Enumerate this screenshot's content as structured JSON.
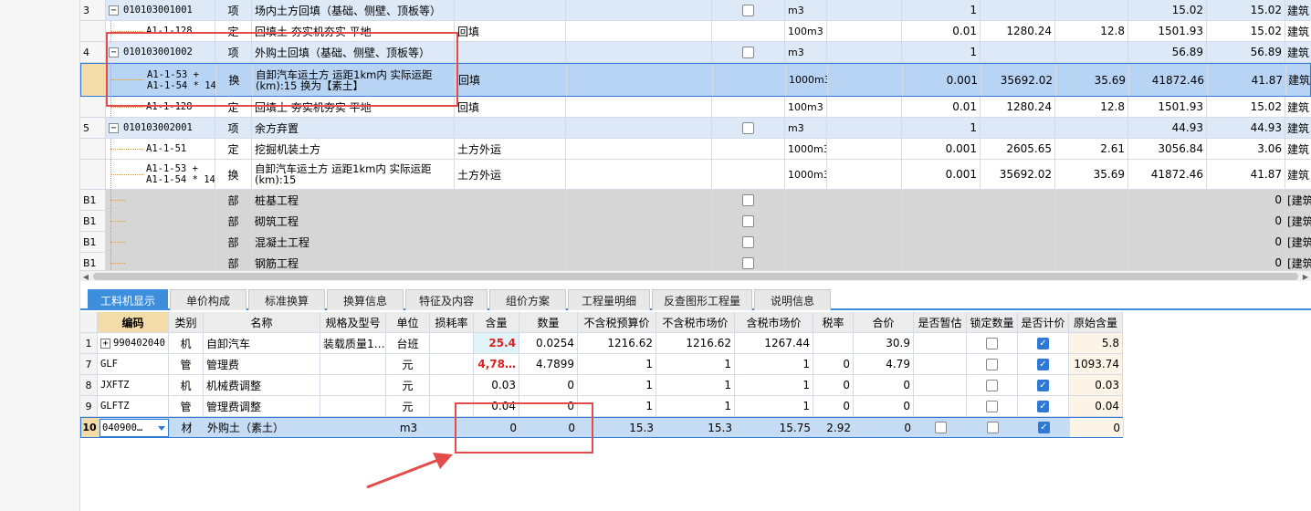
{
  "upper_table": {
    "rows": [
      {
        "type": "item",
        "idx": "3",
        "code": "010103001001",
        "kind": "项",
        "name": "场内土方回填（基础、侧壁、顶板等）",
        "spec": "",
        "unit": "m3",
        "qty": "1",
        "price": "",
        "labor": "",
        "budget": "15.02",
        "market": "15.02",
        "last": "建筑"
      },
      {
        "type": "sub",
        "idx": "",
        "code": "A1-1-128",
        "kind": "定",
        "name": "回填土 夯实机夯实 平地",
        "spec": "回填",
        "unit": "100m3",
        "qty": "0.01",
        "price": "1280.24",
        "labor": "12.8",
        "budget": "1501.93",
        "market": "15.02",
        "last": "建筑"
      },
      {
        "type": "item",
        "idx": "4",
        "code": "010103001002",
        "kind": "项",
        "name": "外购土回填（基础、侧壁、顶板等）",
        "spec": "",
        "unit": "m3",
        "qty": "1",
        "price": "",
        "labor": "",
        "budget": "56.89",
        "market": "56.89",
        "last": "建筑"
      },
      {
        "type": "selected",
        "idx": "",
        "code": "A1-1-53 + A1-1-54 * 14",
        "kind": "换",
        "name": "自卸汽车运土方 运距1km内  实际运距(km):15  换为【素土】",
        "spec": "回填",
        "unit": "1000m3",
        "qty": "0.001",
        "price": "35692.02",
        "labor": "35.69",
        "budget": "41872.46",
        "market": "41.87",
        "last": "建筑"
      },
      {
        "type": "sub",
        "idx": "",
        "code": "A1-1-128",
        "kind": "定",
        "name": "回填土 夯实机夯实 平地",
        "spec": "回填",
        "unit": "100m3",
        "qty": "0.01",
        "price": "1280.24",
        "labor": "12.8",
        "budget": "1501.93",
        "market": "15.02",
        "last": "建筑"
      },
      {
        "type": "item",
        "idx": "5",
        "code": "010103002001",
        "kind": "项",
        "name": "余方弃置",
        "spec": "",
        "unit": "m3",
        "qty": "1",
        "price": "",
        "labor": "",
        "budget": "44.93",
        "market": "44.93",
        "last": "建筑"
      },
      {
        "type": "sub",
        "idx": "",
        "code": "A1-1-51",
        "kind": "定",
        "name": "挖掘机装土方",
        "spec": "土方外运",
        "unit": "1000m3",
        "qty": "0.001",
        "price": "2605.65",
        "labor": "2.61",
        "budget": "3056.84",
        "market": "3.06",
        "last": "建筑"
      },
      {
        "type": "sub",
        "idx": "",
        "code": "A1-1-53 + A1-1-54 * 14",
        "kind": "换",
        "name": "自卸汽车运土方 运距1km内  实际运距(km):15",
        "spec": "土方外运",
        "unit": "1000m3",
        "qty": "0.001",
        "price": "35692.02",
        "labor": "35.69",
        "budget": "41872.46",
        "market": "41.87",
        "last": "建筑"
      },
      {
        "type": "part",
        "idx": "B1",
        "code": "",
        "kind": "部",
        "name": "桩基工程",
        "spec": "",
        "unit": "",
        "qty": "",
        "price": "",
        "labor": "",
        "budget": "",
        "market": "0",
        "last": "[建筑"
      },
      {
        "type": "part",
        "idx": "B1",
        "code": "",
        "kind": "部",
        "name": "砌筑工程",
        "spec": "",
        "unit": "",
        "qty": "",
        "price": "",
        "labor": "",
        "budget": "",
        "market": "0",
        "last": "[建筑"
      },
      {
        "type": "part",
        "idx": "B1",
        "code": "",
        "kind": "部",
        "name": "混凝土工程",
        "spec": "",
        "unit": "",
        "qty": "",
        "price": "",
        "labor": "",
        "budget": "",
        "market": "0",
        "last": "[建筑"
      },
      {
        "type": "part",
        "idx": "B1",
        "code": "",
        "kind": "部",
        "name": "钢筋工程",
        "spec": "",
        "unit": "",
        "qty": "",
        "price": "",
        "labor": "",
        "budget": "",
        "market": "0",
        "last": "[建筑"
      }
    ]
  },
  "tabs": [
    "工料机显示",
    "单价构成",
    "标准换算",
    "换算信息",
    "特征及内容",
    "组价方案",
    "工程量明细",
    "反查图形工程量",
    "说明信息"
  ],
  "lower_table": {
    "headers": [
      "编码",
      "类别",
      "名称",
      "规格及型号",
      "单位",
      "损耗率",
      "含量",
      "数量",
      "不含税预算价",
      "不含税市场价",
      "含税市场价",
      "税率",
      "合价",
      "是否暂估",
      "锁定数量",
      "是否计价",
      "原始含量"
    ],
    "rows": [
      {
        "idx": "1",
        "code": "990402040",
        "cat": "机",
        "name": "自卸汽车",
        "spec": "装载质量1…",
        "unit": "台班",
        "loss": "",
        "content": "25.4",
        "qty": "0.0254",
        "p1": "1216.62",
        "p2": "1216.62",
        "p3": "1267.44",
        "tax": "",
        "total": "30.9",
        "est": false,
        "lock": false,
        "priced": true,
        "orig": "5.8"
      },
      {
        "idx": "7",
        "code": "GLF",
        "cat": "管",
        "name": "管理费",
        "spec": "",
        "unit": "元",
        "loss": "",
        "content": "4,78…",
        "qty": "4.7899",
        "p1": "1",
        "p2": "1",
        "p3": "1",
        "tax": "0",
        "total": "4.79",
        "est": false,
        "lock": false,
        "priced": true,
        "orig": "1093.74"
      },
      {
        "idx": "8",
        "code": "JXFTZ",
        "cat": "机",
        "name": "机械费调整",
        "spec": "",
        "unit": "元",
        "loss": "",
        "content": "0.03",
        "qty": "0",
        "p1": "1",
        "p2": "1",
        "p3": "1",
        "tax": "0",
        "total": "0",
        "est": false,
        "lock": false,
        "priced": true,
        "orig": "0.03"
      },
      {
        "idx": "9",
        "code": "GLFTZ",
        "cat": "管",
        "name": "管理费调整",
        "spec": "",
        "unit": "元",
        "loss": "",
        "content": "0.04",
        "qty": "0",
        "p1": "1",
        "p2": "1",
        "p3": "1",
        "tax": "0",
        "total": "0",
        "est": false,
        "lock": false,
        "priced": true,
        "orig": "0.04"
      },
      {
        "idx": "10",
        "code": "040900…",
        "cat": "材",
        "name": "外购土（素土）",
        "spec": "",
        "unit": "m3",
        "loss": "",
        "content": "0",
        "qty": "0",
        "p1": "15.3",
        "p2": "15.3",
        "p3": "15.75",
        "tax": "2.92",
        "total": "0",
        "est": false,
        "lock": false,
        "priced": true,
        "orig": "0"
      }
    ]
  },
  "colors": {
    "accent": "#3d8fde",
    "annotation": "#e54b4b",
    "selected_row": "#b8d4f4"
  }
}
